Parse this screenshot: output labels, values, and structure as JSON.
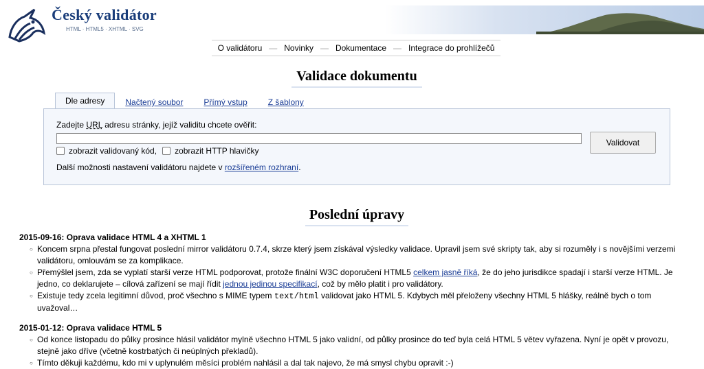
{
  "header": {
    "title": "Český validátor",
    "subtitle": "HTML · HTML5 · XHTML · SVG"
  },
  "nav": {
    "items": [
      "O validátoru",
      "Novinky",
      "Dokumentace",
      "Integrace do prohlížečů"
    ],
    "separator": "—"
  },
  "validation": {
    "title": "Validace dokumentu",
    "tabs": [
      "Dle adresy",
      "Načtený soubor",
      "Přímý vstup",
      "Z šablony"
    ],
    "active_tab": "Dle adresy",
    "url_label_before": "Zadejte ",
    "url_label_abbr": "URL",
    "url_label_after": " adresu stránky, jejíž validitu chcete ověřit:",
    "url_value": "",
    "validate_button": "Validovat",
    "option_show_code": "zobrazit validovaný kód,",
    "option_show_headers": "zobrazit HTTP hlavičky",
    "more_before": "Další možnosti nastavení validátoru najdete v ",
    "more_link": "rozšířeném rozhraní",
    "more_after": "."
  },
  "news": {
    "title": "Poslední úpravy",
    "items": [
      {
        "heading": "2015-09-16: Oprava validace HTML 4 a XHTML 1",
        "p1": "Koncem srpna přestal fungovat poslední mirror validátoru 0.7.4, skrze který jsem získával výsledky validace. Upravil jsem své skripty tak, aby si rozuměly i s novějšími verzemi validátoru, omlouvám se za komplikace.",
        "p2_a": "Přemýšlel jsem, zda se vyplatí starší verze HTML podporovat, protože finální W3C doporučení HTML5 ",
        "p2_link1": "celkem jasně říká",
        "p2_b": ", že do jeho jurisdikce spadají i starší verze HTML. Je jedno, co deklarujete – cílová zařízení se mají řídit ",
        "p2_link2": "jednou jedinou specifikací",
        "p2_c": ", což by mělo platit i pro validátory.",
        "p3_a": "Existuje tedy zcela legitimní důvod, proč všechno s MIME typem ",
        "p3_code": "text/html",
        "p3_b": " validovat jako HTML 5. Kdybych měl přeloženy všechny HTML 5 hlášky, reálně bych o tom uvažoval…"
      },
      {
        "heading": "2015-01-12: Oprava validace HTML 5",
        "p1": "Od konce listopadu do půlky prosince hlásil validátor mylně všechno HTML 5 jako validní, od půlky prosince do teď byla celá HTML 5 větev vyřazena. Nyní je opět v provozu, stejně jako dříve (včetně kostrbatých či neúplných překladů).",
        "p2": "Tímto děkuji každému, kdo mi v uplynulém měsíci problém nahlásil a dal tak najevo, že má smysl chybu opravit :-)"
      }
    ]
  },
  "colors": {
    "brand": "#1a3d7a",
    "link": "#1a3d96",
    "form_bg": "#f4f7fc",
    "form_border": "#b8c4d8"
  },
  "icons": [
    "unicorn-logo-icon",
    "hill-landscape-image"
  ]
}
